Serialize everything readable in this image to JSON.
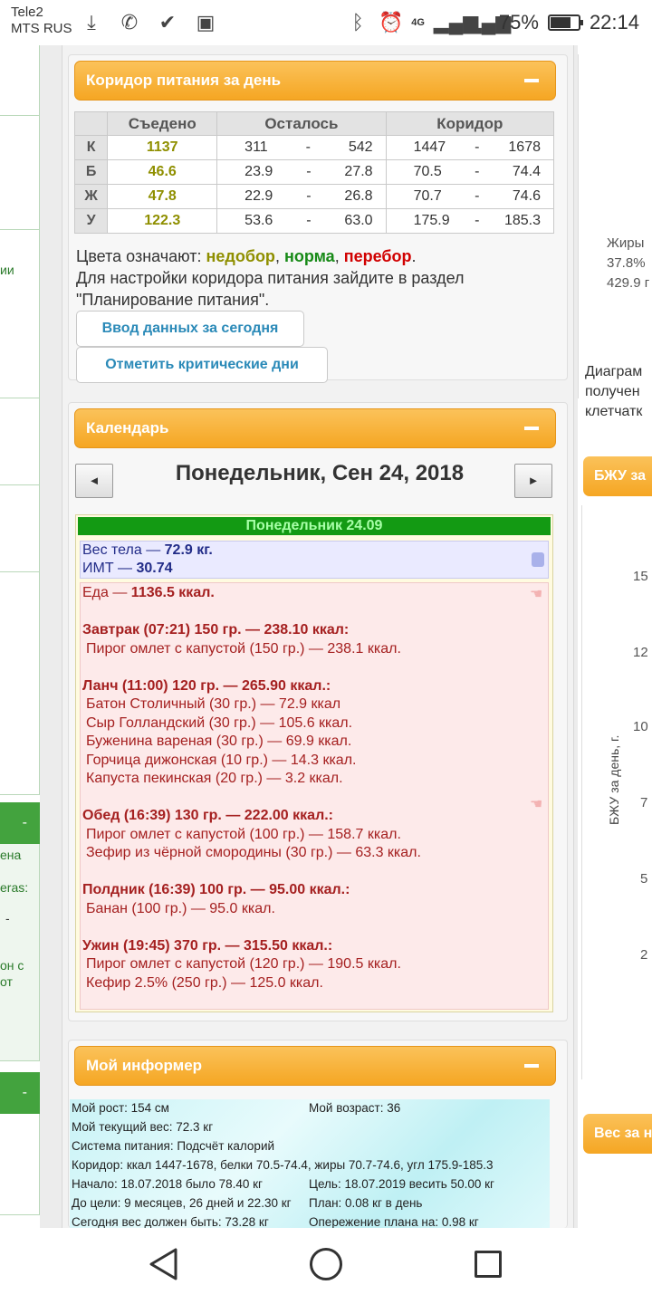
{
  "status_bar": {
    "carrier_1": "Tele2",
    "carrier_2": "MTS RUS",
    "network": "4G",
    "battery_percent": "75%",
    "battery_level": 0.75,
    "time": "22:14"
  },
  "nutrition_panel": {
    "title": "Коридор питания за день",
    "headers": {
      "eaten": "Съедено",
      "remaining": "Осталось",
      "corridor": "Коридор"
    },
    "rows": [
      {
        "label": "К",
        "eaten": "1137",
        "rem_min": "311",
        "rem_max": "542",
        "cor_min": "1447",
        "cor_max": "1678"
      },
      {
        "label": "Б",
        "eaten": "46.6",
        "rem_min": "23.9",
        "rem_max": "27.8",
        "cor_min": "70.5",
        "cor_max": "74.4"
      },
      {
        "label": "Ж",
        "eaten": "47.8",
        "rem_min": "22.9",
        "rem_max": "26.8",
        "cor_min": "70.7",
        "cor_max": "74.6"
      },
      {
        "label": "У",
        "eaten": "122.3",
        "rem_min": "53.6",
        "rem_max": "63.0",
        "cor_min": "175.9",
        "cor_max": "185.3"
      }
    ],
    "dash": "-",
    "legend_prefix": "Цвета означают:",
    "legend_under": "недобор",
    "legend_norm": "норма",
    "legend_over": "перебор",
    "comma": ",",
    "dot": ".",
    "setup_hint_1": "Для настройки коридора питания зайдите в раздел",
    "setup_hint_2": "\"Планирование питания\".",
    "btn_input_today": "Ввод данных за сегодня",
    "btn_critical_days": "Отметить критические дни"
  },
  "calendar_panel": {
    "title": "Календарь",
    "prev": "◄",
    "next": "►",
    "date_title": "Понедельник, Сен 24, 2018",
    "day_header": "Понедельник 24.09",
    "weight_label": "Вес тела — ",
    "weight_value": "72.9 кг.",
    "bmi_label": "ИМТ — ",
    "bmi_value": "30.74",
    "food_label": "Еда — ",
    "food_value": "1136.5 ккал.",
    "meals": [
      {
        "head": "Завтрак (07:21) 150 гр. — 238.10 ккал:",
        "items": [
          "Пирог омлет с капустой (150 гр.) — 238.1 ккал."
        ]
      },
      {
        "head": "Ланч (11:00) 120 гр. — 265.90 ккал.:",
        "items": [
          "Батон Столичный (30 гр.) — 72.9 ккал",
          "Сыр Голландский (30 гр.) — 105.6 ккал.",
          "Буженина вареная (30 гр.) — 69.9 ккал.",
          "Горчица дижонская (10 гр.) — 14.3 ккал.",
          "Капуста пекинская (20 гр.) — 3.2 ккал."
        ]
      },
      {
        "head": "Обед (16:39) 130 гр. — 222.00 ккал.:",
        "items": [
          "Пирог омлет с капустой (100 гр.) — 158.7 ккал.",
          "Зефир из чёрной смородины (30 гр.) — 63.3 ккал."
        ]
      },
      {
        "head": "Полдник (16:39) 100 гр. — 95.00 ккал.:",
        "items": [
          "Банан (100 гр.) — 95.0 ккал."
        ]
      },
      {
        "head": "Ужин (19:45) 370 гр. — 315.50 ккал.:",
        "items": [
          "Пирог омлет с капустой (120 гр.) — 190.5 ккал.",
          "Кефир 2.5% (250 гр.) — 125.0 ккал."
        ]
      }
    ]
  },
  "informer_panel": {
    "title": "Мой информер",
    "height": "Мой рост: 154 см",
    "age": "Мой возраст: 36",
    "current_weight": "Мой текущий вес: 72.3 кг",
    "system": "Система питания: Подсчёт калорий",
    "corridor": "Коридор: ккал 1447-1678, белки 70.5-74.4, жиры 70.7-74.6, угл 175.9-185.3",
    "start": "Начало: 18.07.2018 было 78.40 кг",
    "goal": "Цель: 18.07.2019 весить 50.00 кг",
    "to_goal": "До цели: 9 месяцев, 26 дней и 22.30 кг",
    "plan": "План: 0.08 кг в день",
    "today_should": "Сегодня вес должен быть: 73.28 кг",
    "ahead": "Опережение плана на: 0.98 кг"
  },
  "left_strip": {
    "text_1": "ии",
    "green_1": "-",
    "text_2": "ена",
    "text_3": "eras:",
    "text_4": "-",
    "text_5": "он с",
    "text_6": "от",
    "green_2": "-"
  },
  "right_strip": {
    "fats_label": "Жиры",
    "fats_pct": "37.8%",
    "fats_val": "429.9 г",
    "diag_1": "Диаграм",
    "diag_2": "получен",
    "diag_3": "клетчатк",
    "bju_head": "БЖУ за",
    "axis_label": "БЖУ за день, г.",
    "ticks": [
      "15",
      "12",
      "10",
      "7",
      "5",
      "2"
    ],
    "weight_head": "Вес за н"
  }
}
